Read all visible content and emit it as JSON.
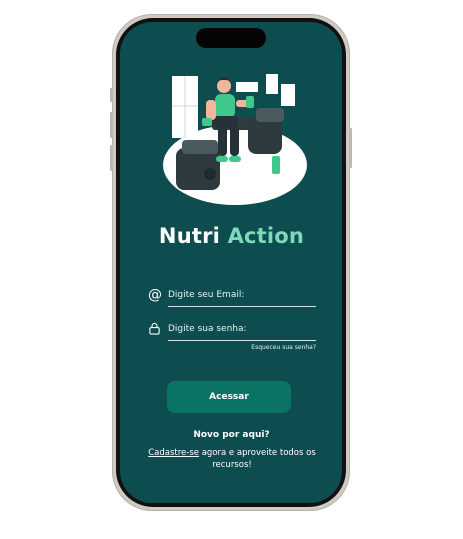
{
  "app": {
    "title_part1": "Nutri",
    "title_part2": "Action"
  },
  "login": {
    "email_icon": "at-icon",
    "email_placeholder": "Digite seu Email:",
    "password_icon": "lock-icon",
    "password_placeholder": "Digite sua senha:",
    "forgot_link": "Esqueceu sua senha?",
    "submit_label": "Acessar"
  },
  "signup": {
    "question": "Novo por aqui?",
    "link_label": "Cadastre-se",
    "rest_text": "agora e aproveite todos os recursos!"
  },
  "colors": {
    "screen_bg": "#0d4d50",
    "accent_text": "#7fd8b8",
    "button_bg": "#0a7364"
  }
}
